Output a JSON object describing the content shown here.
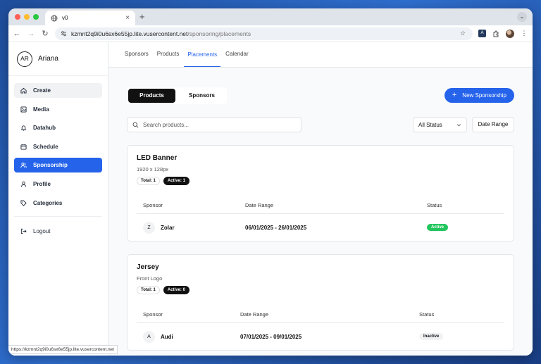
{
  "browser": {
    "tab_title": "v0",
    "new_tab": "+",
    "url_host": "kzmnt2q9i0u6sx6e55jp.lite.vusercontent.net",
    "url_path": "/sponsoring/placements",
    "status_url": "https://kzmnt2q9i0u6sx6e55jp.lite.vusercontent.net",
    "traffic_colors": [
      "#ff5f57",
      "#febc2e",
      "#28c840"
    ]
  },
  "user": {
    "initials": "AR",
    "name": "Ariana"
  },
  "sidebar": {
    "items": [
      {
        "label": "Create",
        "icon": "home-icon"
      },
      {
        "label": "Media",
        "icon": "image-icon"
      },
      {
        "label": "Datahub",
        "icon": "bell-icon"
      },
      {
        "label": "Schedule",
        "icon": "calendar-icon"
      },
      {
        "label": "Sponsorship",
        "icon": "users-icon"
      },
      {
        "label": "Profile",
        "icon": "user-icon"
      },
      {
        "label": "Categories",
        "icon": "tag-icon"
      }
    ],
    "logout": "Logout",
    "active_color": "#2563eb"
  },
  "topnav": {
    "sponsors": "Sponsors",
    "products": "Products",
    "placements": "Placements",
    "calendar": "Calendar"
  },
  "toggle": {
    "products": "Products",
    "sponsors": "Sponsors"
  },
  "new_button": "New Sponsorship",
  "search": {
    "placeholder": "Search products..."
  },
  "status_filter": "All Status",
  "date_range_button": "Date Range",
  "table_headers": {
    "sponsor": "Sponsor",
    "date_range": "Date Range",
    "status": "Status"
  },
  "placements": [
    {
      "title": "LED Banner",
      "subtitle": "1920 x 128px",
      "total": "Total: 1",
      "active": "Active: 1",
      "rows": [
        {
          "initial": "Z",
          "sponsor": "Zolar",
          "date_range": "06/01/2025 - 26/01/2025",
          "status": "Active"
        }
      ]
    },
    {
      "title": "Jersey",
      "subtitle": "Front Logo",
      "total": "Total: 1",
      "active": "Active: 0",
      "rows": [
        {
          "initial": "A",
          "sponsor": "Audi",
          "date_range": "07/01/2025 - 09/01/2025",
          "status": "Inactive"
        }
      ]
    }
  ]
}
